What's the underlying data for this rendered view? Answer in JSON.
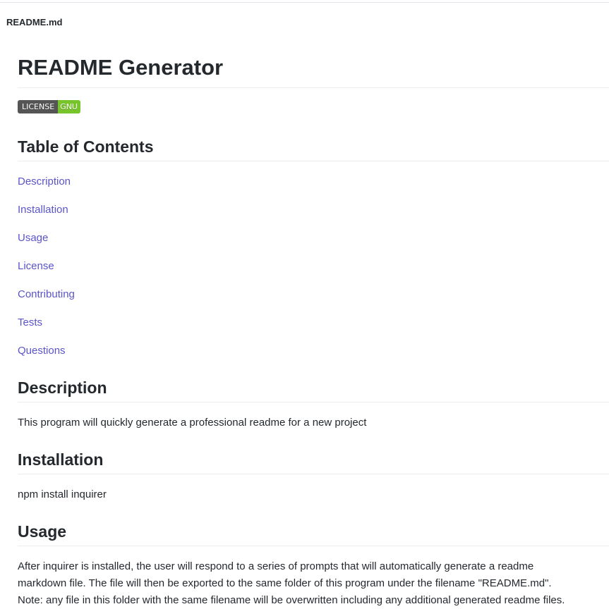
{
  "file_header": {
    "filename": "README.md"
  },
  "readme": {
    "title": "README Generator",
    "badge": {
      "label": "LICENSE",
      "value": "GNU",
      "label_color": "#555555",
      "value_color": "#78c42b"
    },
    "toc": {
      "heading": "Table of Contents",
      "items": [
        {
          "label": "Description"
        },
        {
          "label": "Installation"
        },
        {
          "label": "Usage"
        },
        {
          "label": "License"
        },
        {
          "label": "Contributing"
        },
        {
          "label": "Tests"
        },
        {
          "label": "Questions"
        }
      ]
    },
    "description": {
      "heading": "Description",
      "text": "This program will quickly generate a professional readme for a new project"
    },
    "installation": {
      "heading": "Installation",
      "text": "npm install inquirer"
    },
    "usage": {
      "heading": "Usage",
      "lines": [
        "After inquirer is installed, the user will respond to a series of prompts that will automatically generate a readme",
        "markdown file. The file will then be exported to the same folder of this program under the filename \"README.md\".",
        "Note: any file in this folder with the same filename will be overwritten including any additional generated readme files."
      ]
    }
  },
  "colors": {
    "link": "#5a54c9",
    "text": "#24292e",
    "divider": "#eaecef"
  }
}
